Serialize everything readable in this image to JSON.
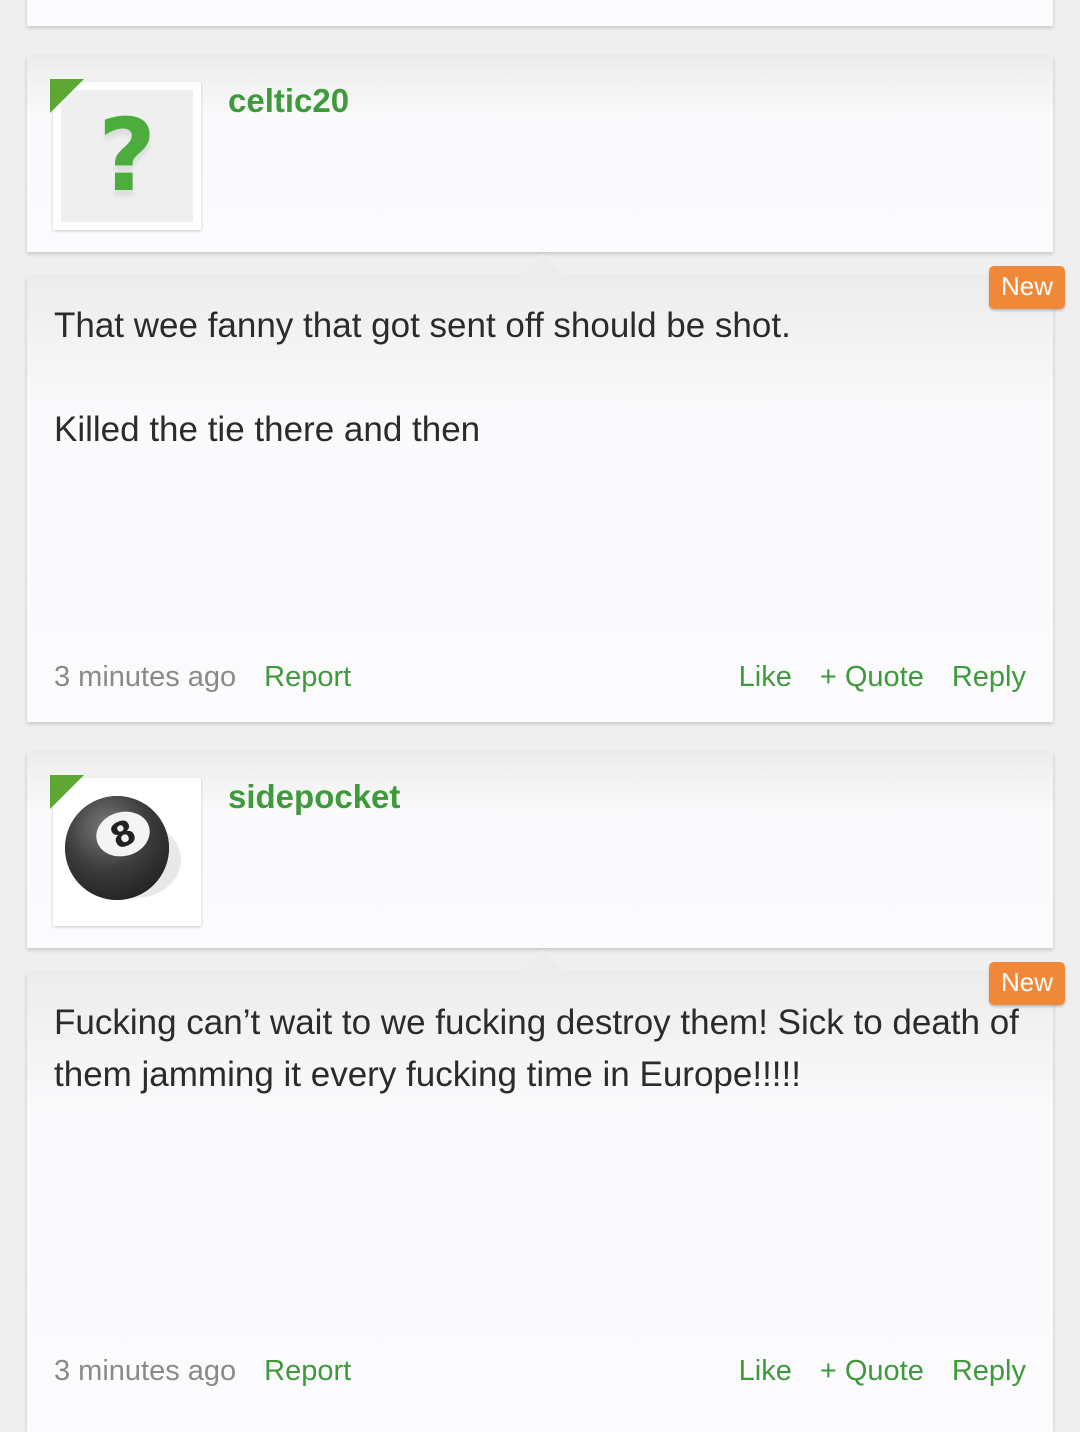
{
  "posts": [
    {
      "username": "celtic20",
      "avatar_icon": "question-mark-icon",
      "badge": "New",
      "text_lines": [
        "That wee fanny that got sent off should be shot.",
        "Killed the tie there and then"
      ],
      "time": "3 minutes ago",
      "report_label": "Report",
      "like_label": "Like",
      "quote_label": "+ Quote",
      "reply_label": "Reply"
    },
    {
      "username": "sidepocket",
      "avatar_icon": "eight-ball-icon",
      "badge": "New",
      "text_lines": [
        "Fucking can’t wait to we fucking destroy them! Sick to death of them jamming it every fucking time in Europe!!!!!"
      ],
      "time": "3 minutes ago",
      "report_label": "Report",
      "like_label": "Like",
      "quote_label": "+ Quote",
      "reply_label": "Reply"
    }
  ],
  "colors": {
    "accent_green": "#3e9a3a",
    "badge_orange": "#f0883a",
    "corner_green": "#5da832"
  }
}
